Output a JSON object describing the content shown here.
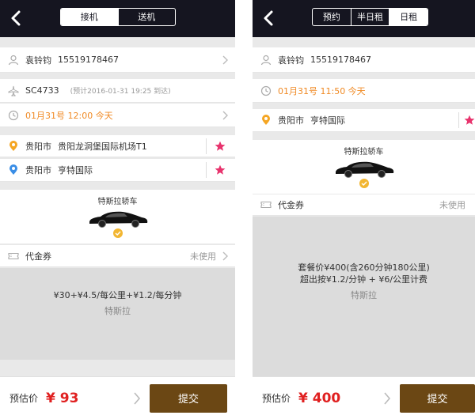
{
  "left": {
    "tabs": [
      "接机",
      "送机"
    ],
    "passenger_name": "袁铃钧",
    "passenger_phone": "15519178467",
    "flight_no": "SC4733",
    "flight_note": "(预计2016-01-31 19:25 到达)",
    "pickup_time": "01月31号 12:00 今天",
    "from_city": "贵阳市",
    "from_place": "贵阳龙洞堡国际机场T1",
    "to_city": "贵阳市",
    "to_place": "亨特国际",
    "car_name": "特斯拉轿车",
    "voucher_label": "代金券",
    "voucher_status": "未使用",
    "price_rule": "¥30+¥4.5/每公里+¥1.2/每分钟",
    "price_car": "特斯拉",
    "estimate_label": "预估价",
    "estimate_value": "¥ 93",
    "submit_label": "提交"
  },
  "right": {
    "tabs": [
      "预约",
      "半日租",
      "日租"
    ],
    "passenger_name": "袁铃钧",
    "passenger_phone": "15519178467",
    "pickup_time": "01月31号 11:50 今天",
    "city": "贵阳市",
    "place": "亨特国际",
    "car_name": "特斯拉轿车",
    "voucher_label": "代金券",
    "voucher_status": "未使用",
    "package_line1": "套餐价¥400(含260分钟180公里)",
    "package_line2": "超出按¥1.2/分钟 + ¥6/公里计费",
    "price_car": "特斯拉",
    "estimate_label": "预估价",
    "estimate_value": "¥ 400",
    "submit_label": "提交"
  },
  "colors": {
    "navbar": "#151520",
    "accent_orange": "#f08a24",
    "price_red": "#e02020",
    "submit_brown": "#6b4714",
    "star_pink": "#e8336d",
    "pin_orange": "#f5a623",
    "pin_blue": "#3a8ee6",
    "check_gold": "#f2b632"
  }
}
